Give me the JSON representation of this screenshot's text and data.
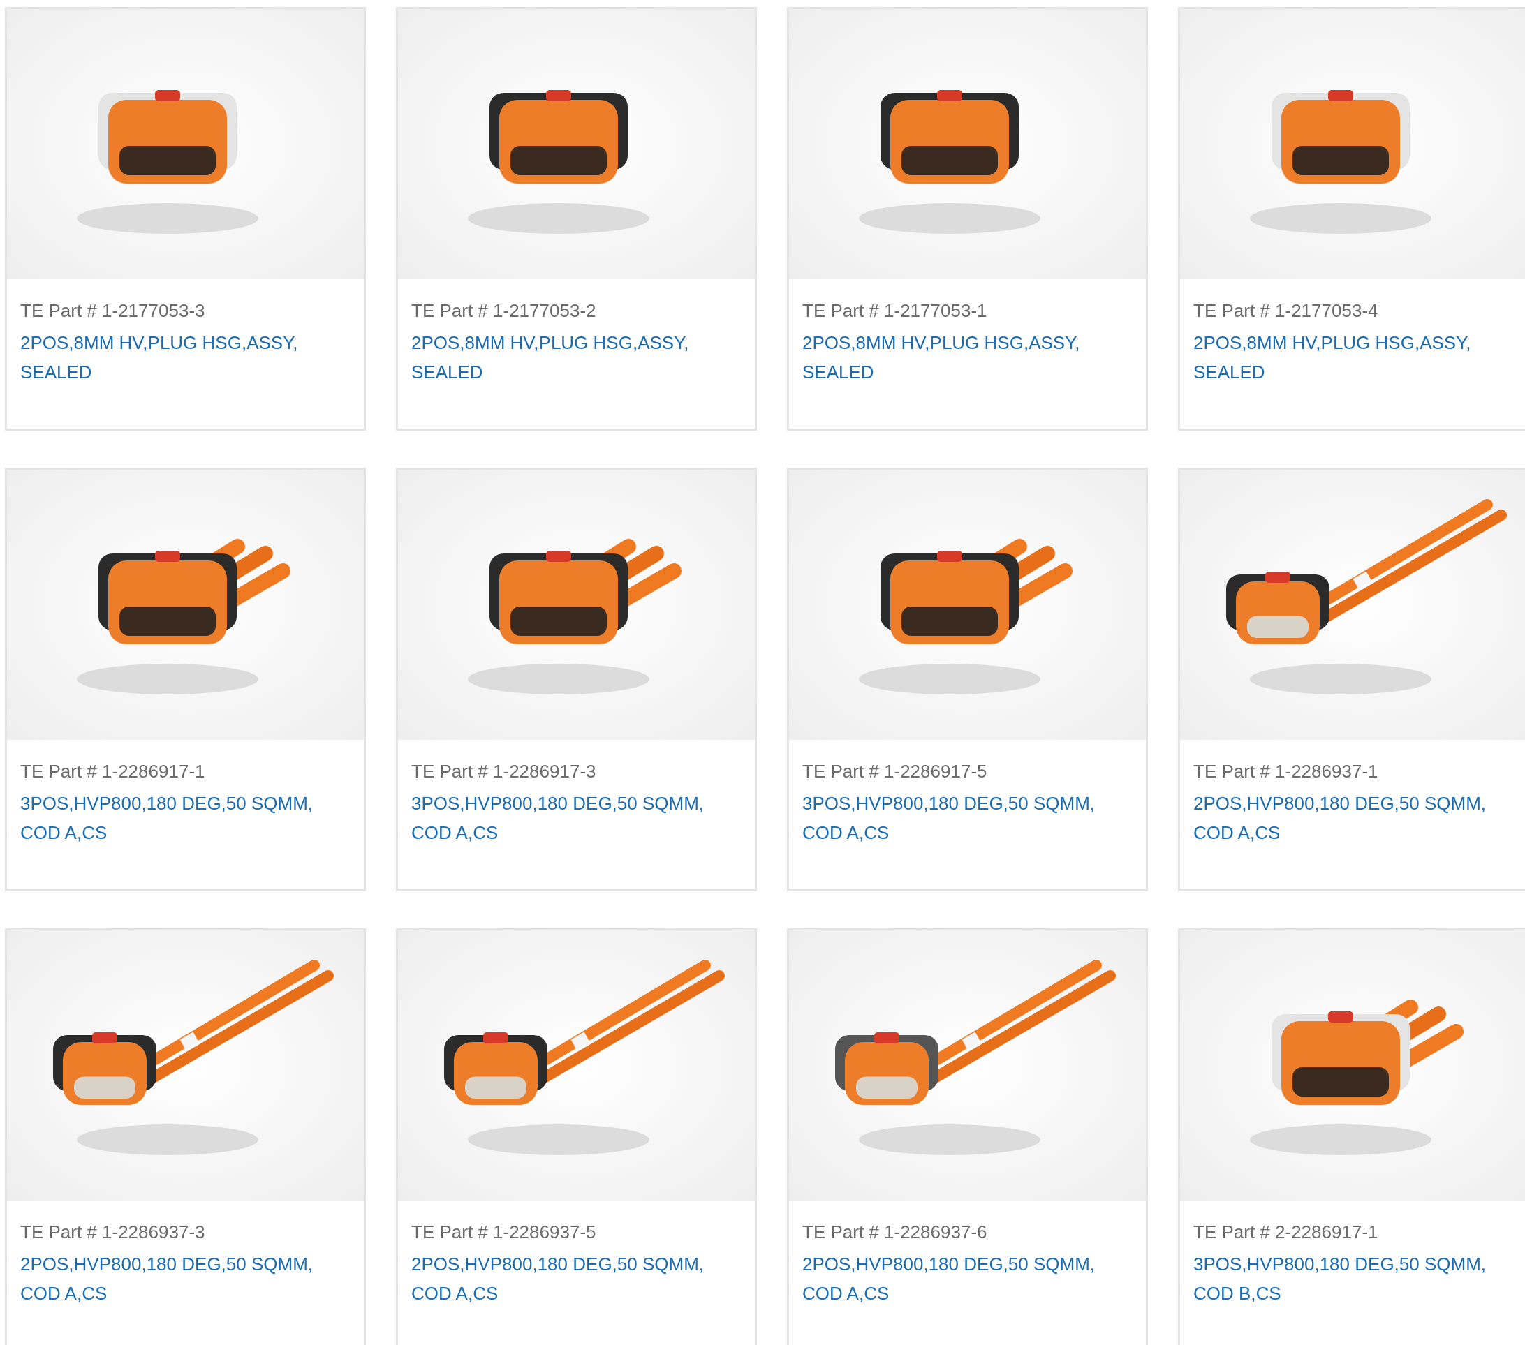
{
  "products": [
    {
      "part": "TE Part # 1-2177053-3",
      "description": "2POS,8MM HV,PLUG HSG,ASSY, SEALED"
    },
    {
      "part": "TE Part # 1-2177053-2",
      "description": "2POS,8MM HV,PLUG HSG,ASSY, SEALED"
    },
    {
      "part": "TE Part # 1-2177053-1",
      "description": "2POS,8MM HV,PLUG HSG,ASSY, SEALED"
    },
    {
      "part": "TE Part # 1-2177053-4",
      "description": "2POS,8MM HV,PLUG HSG,ASSY, SEALED"
    },
    {
      "part": "TE Part # 1-2286917-1",
      "description": "3POS,HVP800,180 DEG,50 SQMM, COD A,CS"
    },
    {
      "part": "TE Part # 1-2286917-3",
      "description": "3POS,HVP800,180 DEG,50 SQMM, COD A,CS"
    },
    {
      "part": "TE Part # 1-2286917-5",
      "description": "3POS,HVP800,180 DEG,50 SQMM, COD A,CS"
    },
    {
      "part": "TE Part # 1-2286937-1",
      "description": "2POS,HVP800,180 DEG,50 SQMM, COD A,CS"
    },
    {
      "part": "TE Part # 1-2286937-3",
      "description": "2POS,HVP800,180 DEG,50 SQMM, COD A,CS"
    },
    {
      "part": "TE Part # 1-2286937-5",
      "description": "2POS,HVP800,180 DEG,50 SQMM, COD A,CS"
    },
    {
      "part": "TE Part # 1-2286937-6",
      "description": "2POS,HVP800,180 DEG,50 SQMM, COD A,CS"
    },
    {
      "part": "TE Part # 2-2286917-1",
      "description": "3POS,HVP800,180 DEG,50 SQMM, COD B,CS"
    }
  ]
}
